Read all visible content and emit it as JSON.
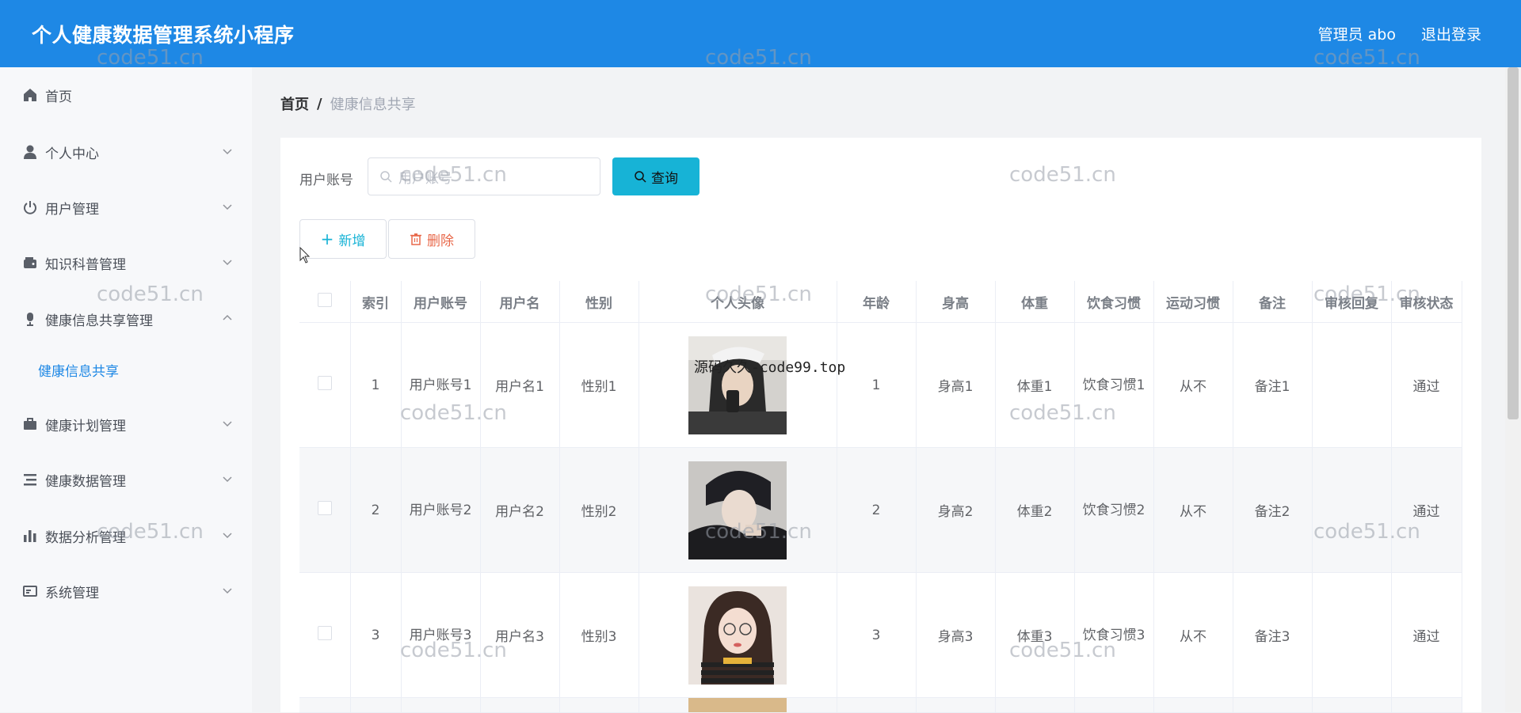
{
  "header": {
    "title": "个人健康数据管理系统小程序",
    "user": "管理员 abo",
    "logout": "退出登录"
  },
  "sidebar": {
    "items": [
      {
        "label": "首页",
        "icon": "home-icon"
      },
      {
        "label": "个人中心",
        "icon": "user-icon"
      },
      {
        "label": "用户管理",
        "icon": "power-icon"
      },
      {
        "label": "知识科普管理",
        "icon": "wallet-icon"
      },
      {
        "label": "健康信息共享管理",
        "icon": "mic-icon"
      },
      {
        "label": "健康计划管理",
        "icon": "briefcase-icon"
      },
      {
        "label": "健康数据管理",
        "icon": "list-icon"
      },
      {
        "label": "数据分析管理",
        "icon": "bar-chart-icon"
      },
      {
        "label": "系统管理",
        "icon": "card-icon"
      }
    ],
    "sub_item": "健康信息共享"
  },
  "breadcrumb": {
    "home": "首页",
    "sep": "/",
    "current": "健康信息共享"
  },
  "search": {
    "label": "用户账号",
    "placeholder": "用户账号",
    "button": "查询"
  },
  "actions": {
    "add": "新增",
    "delete": "删除"
  },
  "table": {
    "headers": [
      "索引",
      "用户账号",
      "用户名",
      "性别",
      "个人头像",
      "年龄",
      "身高",
      "体重",
      "饮食习惯",
      "运动习惯",
      "备注",
      "审核回复",
      "审核状态"
    ],
    "rows": [
      {
        "index": "1",
        "account": "用户账号1",
        "name": "用户名1",
        "gender": "性别1",
        "age": "1",
        "height": "身高1",
        "weight": "体重1",
        "diet": "饮食习惯1",
        "exercise": "从不",
        "note": "备注1",
        "reply": "",
        "status": "通过"
      },
      {
        "index": "2",
        "account": "用户账号2",
        "name": "用户名2",
        "gender": "性别2",
        "age": "2",
        "height": "身高2",
        "weight": "体重2",
        "diet": "饮食习惯2",
        "exercise": "从不",
        "note": "备注2",
        "reply": "",
        "status": "通过"
      },
      {
        "index": "3",
        "account": "用户账号3",
        "name": "用户名3",
        "gender": "性别3",
        "age": "3",
        "height": "身高3",
        "weight": "体重3",
        "diet": "饮食习惯3",
        "exercise": "从不",
        "note": "备注3",
        "reply": "",
        "status": "通过"
      }
    ]
  },
  "watermarks": {
    "site": "code51.cn",
    "source": "源码久久-code99.top"
  },
  "colors": {
    "header": "#1e88e5",
    "search_button": "#17b3d6",
    "delete": "#e8684a"
  }
}
